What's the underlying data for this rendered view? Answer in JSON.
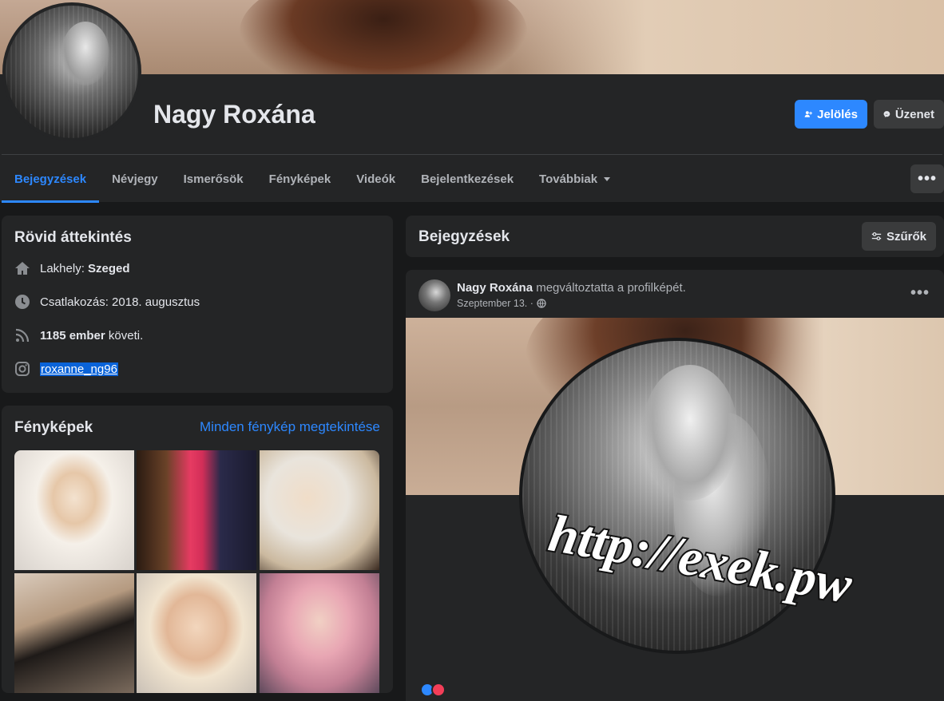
{
  "profile": {
    "name": "Nagy Roxána",
    "primary_button": "Jelölés",
    "secondary_button": "Üzenet"
  },
  "tabs": [
    {
      "label": "Bejegyzések",
      "active": true
    },
    {
      "label": "Névjegy"
    },
    {
      "label": "Ismerősök"
    },
    {
      "label": "Fényképek"
    },
    {
      "label": "Videók"
    },
    {
      "label": "Bejelentkezések"
    },
    {
      "label": "Továbbiak"
    }
  ],
  "more_button": "•••",
  "intro": {
    "title": "Rövid áttekintés",
    "location_label": "Lakhely: ",
    "location_value": "Szeged",
    "joined": "Csatlakozás: 2018. augusztus",
    "followers_count": "1185 ember",
    "followers_suffix": " követi.",
    "instagram": "roxanne_ng96"
  },
  "photos": {
    "title": "Fényképek",
    "link": "Minden fénykép megtekintése"
  },
  "posts_header": {
    "title": "Bejegyzések",
    "filter_button": "Szűrők"
  },
  "post": {
    "author": "Nagy Roxána",
    "action": " megváltoztatta a profilképét.",
    "date": "Szeptember 13. ·",
    "menu": "•••"
  },
  "watermark": "http://exek.pw",
  "colors": {
    "accent": "#2d88ff",
    "card_bg": "#242526",
    "page_bg": "#18191a"
  }
}
